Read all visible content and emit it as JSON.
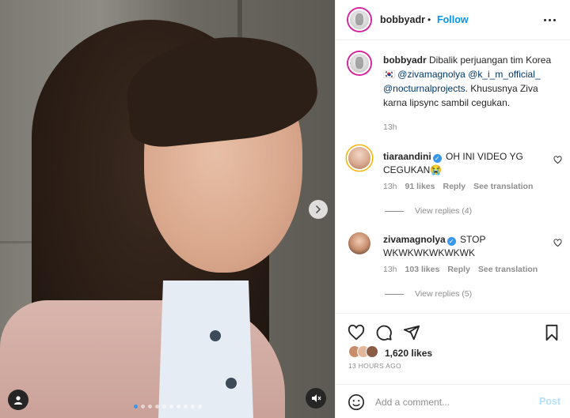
{
  "post": {
    "username": "bobbyadr",
    "separator": "•",
    "follow_label": "Follow",
    "caption_user": "bobbyadr",
    "caption_lines": [
      "Dibalik perjuangan tim",
      "Korea 🇰🇷",
      "Khususnya Ziva karna lipsync sambil",
      "cegukan."
    ],
    "mentions": [
      "@zivamagnolya",
      "@k_i_m_official_",
      "@nocturnalprojects"
    ],
    "caption_time": "13h"
  },
  "comments": [
    {
      "username": "tiaraandini",
      "text_line1": "OH INI VIDEO YG",
      "text_line2": "CEGUKAN😭",
      "time": "13h",
      "likes": "91 likes",
      "reply": "Reply",
      "see_translation": "See translation",
      "view_replies": "View replies (4)"
    },
    {
      "username": "zivamagnolya",
      "text_line1": "STOP",
      "text_line2": "WKWKWKWKWKWK",
      "time": "13h",
      "likes": "103 likes",
      "reply": "Reply",
      "see_translation": "See translation",
      "view_replies": "View replies (5)"
    }
  ],
  "engagement": {
    "likes_count": "1,620",
    "likes_suffix": "likes",
    "posted_ago": "13 HOURS AGO"
  },
  "comment_box": {
    "placeholder": "Add a comment...",
    "post_label": "Post"
  },
  "carousel": {
    "slide_count": 10,
    "active_index": 0
  },
  "icons": [
    "tag-user-icon",
    "mute-icon",
    "chevron-right-icon",
    "more-icon",
    "heart-icon",
    "comment-icon",
    "share-icon",
    "bookmark-icon",
    "emoji-icon",
    "verified-icon"
  ],
  "colors": {
    "link": "#0095f6",
    "mention": "#00376b",
    "muted": "#8e8e8e",
    "verified": "#3897f0",
    "post_disabled": "#b2dffc"
  }
}
